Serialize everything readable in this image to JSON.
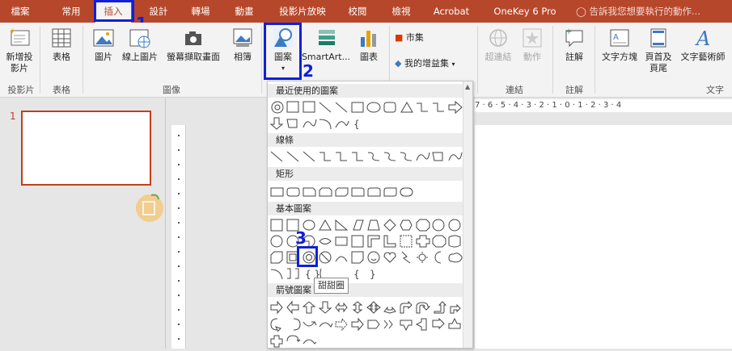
{
  "tabs": [
    "檔案",
    "常用",
    "插入",
    "設計",
    "轉場",
    "動畫",
    "投影片放映",
    "校閱",
    "檢視",
    "Acrobat",
    "OneKey 6 Pro"
  ],
  "tell_me": "告訴我您想要執行的動作...",
  "ribbon": {
    "new_slide": "新增投影片",
    "table": "表格",
    "picture": "圖片",
    "online_picture": "線上圖片",
    "screenshot": "螢幕擷取畫面",
    "album": "相簿",
    "shapes": "圖案",
    "smartart": "SmartArt...",
    "chart": "圖表",
    "store": "市集",
    "my_addins": "我的增益集",
    "hyperlink": "超連結",
    "action": "動作",
    "comment": "註解",
    "textbox": "文字方塊",
    "header_footer": "頁首及頁尾",
    "wordart": "文字藝術師",
    "groups": {
      "slides": "投影片",
      "tables": "表格",
      "images": "圖像",
      "links": "連結",
      "comments": "註解",
      "text": "文字"
    }
  },
  "steps": [
    "1",
    "2",
    "3"
  ],
  "thumbnail_number": "1",
  "hruler_text": "7 · 6 · 5 · 4 · 3 · 2 · 1 · 0 · 1 · 2 · 3 · 4",
  "shape_panel": {
    "recent": "最近使用的圖案",
    "lines": "線條",
    "rectangles": "矩形",
    "basic": "基本圖案",
    "arrows": "箭號圖案"
  },
  "tooltip": "甜甜圈",
  "colors": {
    "accent": "#b7472a",
    "highlight": "#1020d8"
  }
}
